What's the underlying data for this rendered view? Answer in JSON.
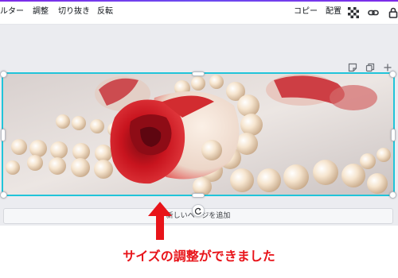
{
  "toolbar": {
    "filter_label": "ルター",
    "adjust_label": "調整",
    "crop_label": "切り抜き",
    "flip_label": "反転",
    "copy_label": "コピー",
    "position_label": "配置"
  },
  "canvas": {
    "add_page_label": "新しいページを追加"
  },
  "annotation": {
    "caption": "サイズの調整ができました",
    "color": "#e8141a"
  },
  "colors": {
    "selection": "#21c4d9",
    "canvas_bg": "#ebecf0"
  }
}
